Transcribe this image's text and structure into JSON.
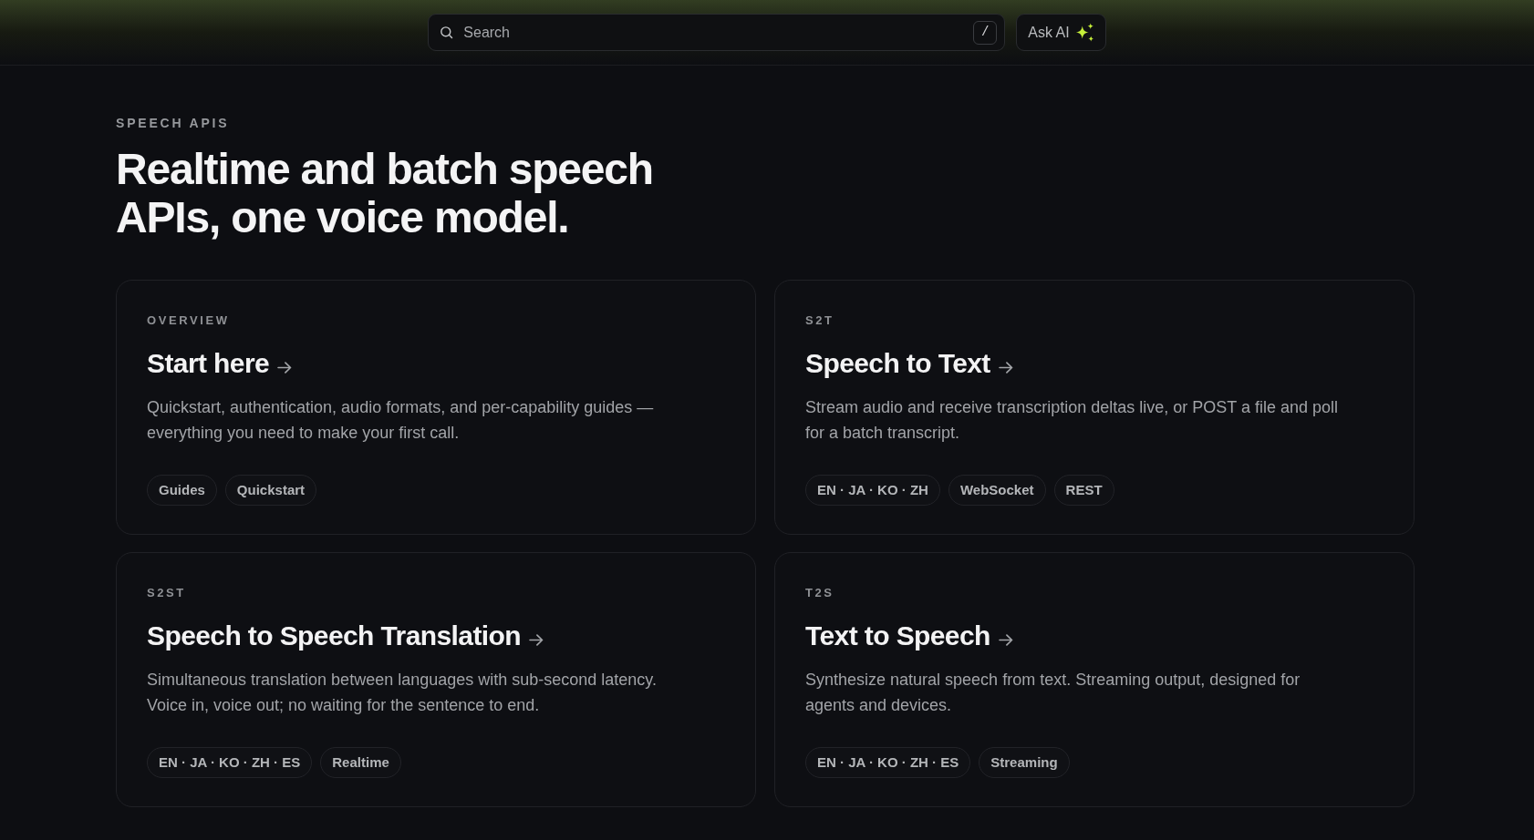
{
  "header": {
    "search": {
      "placeholder": "Search",
      "shortcut": "/"
    },
    "ask_ai": {
      "label": "Ask AI"
    }
  },
  "hero": {
    "eyebrow": "SPEECH APIS",
    "title": "Realtime and batch speech APIs, one voice model."
  },
  "cards": [
    {
      "label": "OVERVIEW",
      "title": "Start here",
      "description": "Quickstart, authentication, audio formats, and per-capability guides — everything you need to make your first call.",
      "tags": [
        "Guides",
        "Quickstart"
      ]
    },
    {
      "label": "S2T",
      "title": "Speech to Text",
      "description": "Stream audio and receive transcription deltas live, or POST a file and poll for a batch transcript.",
      "tags": [
        "EN · JA · KO · ZH",
        "WebSocket",
        "REST"
      ]
    },
    {
      "label": "S2ST",
      "title": "Speech to Speech Translation",
      "description": "Simultaneous translation between languages with sub-second latency. Voice in, voice out; no waiting for the sentence to end.",
      "tags": [
        "EN · JA · KO · ZH · ES",
        "Realtime"
      ]
    },
    {
      "label": "T2S",
      "title": "Text to Speech",
      "description": "Synthesize natural speech from text. Streaming output, designed for agents and devices.",
      "tags": [
        "EN · JA · KO · ZH · ES",
        "Streaming"
      ]
    }
  ]
}
